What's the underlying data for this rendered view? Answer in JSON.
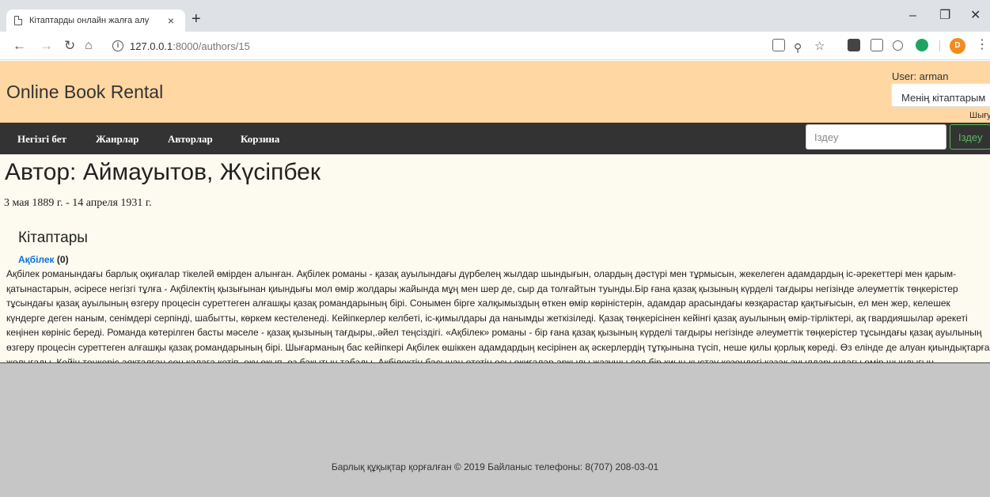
{
  "browser": {
    "tab_title": "Кітаптарды онлайн жалға алу",
    "tab_close": "×",
    "new_tab": "+",
    "url_host": "127.0.0.1",
    "url_rest": ":8000/authors/15",
    "profile_initial": "D",
    "minimize": "–",
    "restore": "❐",
    "close": "✕"
  },
  "header": {
    "brand": "Online Book Rental",
    "user_label": "User: arman",
    "my_books_button": "Менің кітаптарым",
    "logout_link": "Шығу"
  },
  "nav": {
    "items": [
      "Негізгі бет",
      "Жанрлар",
      "Авторлар",
      "Корзина"
    ],
    "search_placeholder": "Іздеу",
    "search_button": "Іздеу"
  },
  "author": {
    "title": "Автор: Аймауытов, Жүсіпбек",
    "dates": "3 мая 1889 г. - 14 апреля 1931 г."
  },
  "books": {
    "heading": "Кітаптары",
    "items": [
      {
        "title": "Ақбілек",
        "count": "(0)",
        "description": "Ақбілек романындағы барлық оқиғалар тікелей өмірден алынған. Ақбілек романы - қазақ ауылындағы дүрбелең жылдар шындығын, олардың дәстүрі мен тұрмысын, жекелеген адамдардың іс-әрекеттері мен қарым-қатынастарын, әсіресе негізгі тұлға - Ақбілектің қызығынан қиындығы мол өмір жолдары жайында мұң мен шер де, сыр да толғайтын туынды.Бір ғана қазақ қызының күрделі тағдыры негізінде әлеуметтік төңкерістер тұсындағы қазақ ауылының өзгеру процесін суреттеген алғашқы қазақ романдарының бірі. Сонымен бірге халқымыздың өткен өмір көріністерін, адамдар арасындағы көзқарастар қақтығысын, ел мен жер, келешек күндерге деген наным, сенімдері серпінді, шабытты, көркем кестеленеді. Кейіпкерлер келбеті, іс-қимылдары да нанымды жеткізіледі. Қазақ төңкерісінен кейінгі қазақ ауылының өмір-тірліктері, ақ гвардияшылар әрекеті кеңінен көрініс береді. Романда көтерілген басты мәселе - қазақ қызының тағдыры,.әйел теңсіздігі. «Ақбілек» романы - бір ғана қазақ қызының күрделі тағдыры негізінде әлеуметтік төңкерістер тұсындағы қазақ ауылының өзгеру процесін суреттеген алғашқы қазақ романдарының бірі. Шығарманың бас кейіпкері Ақбілек өшіккен адамдардың кесірінен ақ әскерлердің тұтқынына түсіп, неше қилы қорлық көреді. Өз елінде де алуан қиындықтарға жолығады. Кейін төңкеріс аяқталған соң қалаға кетіп, оқу оқып, өз бақытын табады. Ақбілектің басынан өтетін осы оқиғалар арқылы жазушы сол бір қиын-қыстау кезеңдегі қазақ ауылдарындағы өмір шындығын, адамдардың түрлі тағдырын кеңінен бейнелейді."
      }
    ]
  },
  "footer": {
    "text": "Барлық құқықтар қорғалған © 2019 Байланыс телефоны: 8(707) 208-03-01"
  }
}
